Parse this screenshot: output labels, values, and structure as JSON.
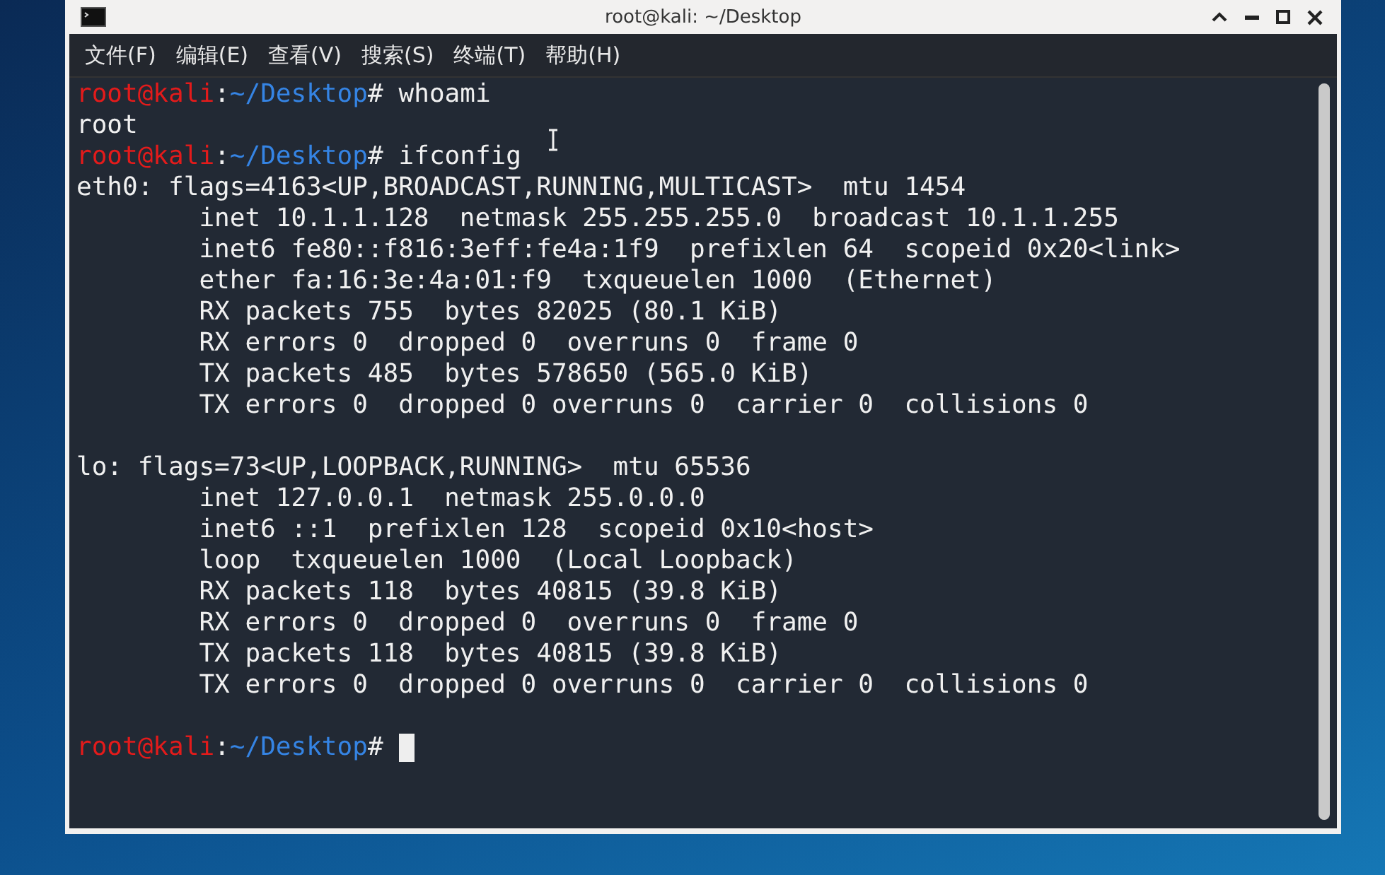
{
  "window": {
    "title": "root@kali: ~/Desktop"
  },
  "menu": [
    "文件(F)",
    "编辑(E)",
    "查看(V)",
    "搜索(S)",
    "终端(T)",
    "帮助(H)"
  ],
  "terminal": {
    "lines": [
      {
        "kind": "prompt",
        "user_host": "root@kali",
        "separator": ":",
        "path": "~/Desktop",
        "symbol": "#",
        "command": "whoami"
      },
      {
        "kind": "output",
        "text": "root"
      },
      {
        "kind": "prompt",
        "user_host": "root@kali",
        "separator": ":",
        "path": "~/Desktop",
        "symbol": "#",
        "command": "ifconfig"
      },
      {
        "kind": "output",
        "text": "eth0: flags=4163<UP,BROADCAST,RUNNING,MULTICAST>  mtu 1454"
      },
      {
        "kind": "output",
        "text": "        inet 10.1.1.128  netmask 255.255.255.0  broadcast 10.1.1.255"
      },
      {
        "kind": "output",
        "text": "        inet6 fe80::f816:3eff:fe4a:1f9  prefixlen 64  scopeid 0x20<link>"
      },
      {
        "kind": "output",
        "text": "        ether fa:16:3e:4a:01:f9  txqueuelen 1000  (Ethernet)"
      },
      {
        "kind": "output",
        "text": "        RX packets 755  bytes 82025 (80.1 KiB)"
      },
      {
        "kind": "output",
        "text": "        RX errors 0  dropped 0  overruns 0  frame 0"
      },
      {
        "kind": "output",
        "text": "        TX packets 485  bytes 578650 (565.0 KiB)"
      },
      {
        "kind": "output",
        "text": "        TX errors 0  dropped 0 overruns 0  carrier 0  collisions 0"
      },
      {
        "kind": "blank"
      },
      {
        "kind": "output",
        "text": "lo: flags=73<UP,LOOPBACK,RUNNING>  mtu 65536"
      },
      {
        "kind": "output",
        "text": "        inet 127.0.0.1  netmask 255.0.0.0"
      },
      {
        "kind": "output",
        "text": "        inet6 ::1  prefixlen 128  scopeid 0x10<host>"
      },
      {
        "kind": "output",
        "text": "        loop  txqueuelen 1000  (Local Loopback)"
      },
      {
        "kind": "output",
        "text": "        RX packets 118  bytes 40815 (39.8 KiB)"
      },
      {
        "kind": "output",
        "text": "        RX errors 0  dropped 0  overruns 0  frame 0"
      },
      {
        "kind": "output",
        "text": "        TX packets 118  bytes 40815 (39.8 KiB)"
      },
      {
        "kind": "output",
        "text": "        TX errors 0  dropped 0 overruns 0  carrier 0  collisions 0"
      },
      {
        "kind": "blank"
      },
      {
        "kind": "prompt",
        "user_host": "root@kali",
        "separator": ":",
        "path": "~/Desktop",
        "symbol": "#",
        "cursor": true
      }
    ]
  }
}
